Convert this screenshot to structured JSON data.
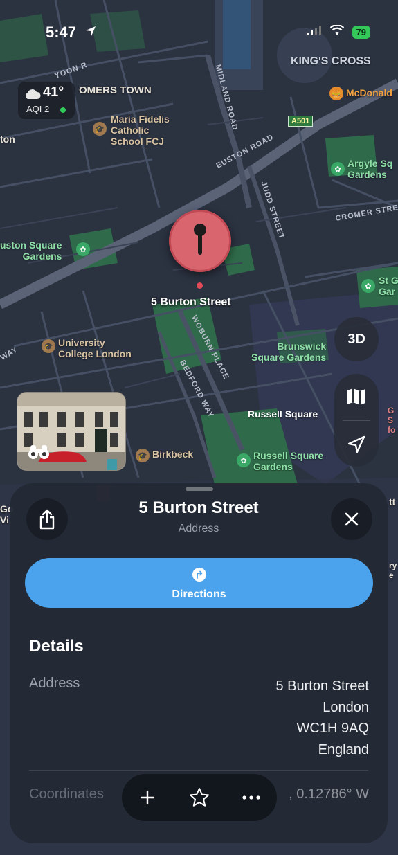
{
  "status_bar": {
    "time": "5:47",
    "battery": "79"
  },
  "weather": {
    "temperature": "41°",
    "aqi_label": "AQI 2"
  },
  "map_labels": {
    "somers_town": "OMERS TOWN",
    "kings_cross": "KING'S CROSS",
    "mcdonalds": "McDonald",
    "maria_fidelis": "Maria Fidelis\nCatholic\nSchool FCJ",
    "ton": "ton",
    "a501": "A501",
    "argyle": "Argyle Sq\nGardens",
    "euston_square_gardens": "uston Square\nGardens",
    "st_gardens": "St G\nGar",
    "ucl": "University\nCollege London",
    "brunswick": "Brunswick\nSquare Gardens",
    "russell_square": "Russell Square",
    "russell_square_gardens": "Russell Square\nGardens",
    "birkbeck": "Birkbeck",
    "gs": "G\nS\nfo",
    "gc": "Go\nVi",
    "tt": "tt",
    "ry": "ry\ne"
  },
  "street_labels": {
    "midland_road": "MIDLAND ROAD",
    "euston_road": "EUSTON ROAD",
    "judd_street": "JUDD STREET",
    "cromer_street": "CROMER STRE",
    "woburn_place": "WOBURN PLACE",
    "bedford_way": "BEDFORD WAY",
    "way": "WAY",
    "yoon": "YOON R"
  },
  "pin": {
    "label": "5 Burton Street"
  },
  "controls": {
    "three_d_label": "3D"
  },
  "place_card": {
    "title": "5 Burton Street",
    "subtitle": "Address",
    "directions_label": "Directions",
    "details_heading": "Details",
    "address_key": "Address",
    "address_lines": [
      "5 Burton Street",
      "London",
      "WC1H 9AQ",
      "England"
    ],
    "coordinates_key": "Coordinates",
    "coordinates_value": ", 0.12786° W"
  },
  "colors": {
    "map_background": "#2a3140",
    "pin": "#d9656e",
    "directions_button": "#4aa3ec",
    "sheet": "#242a34",
    "park": "#2f6b4a"
  },
  "icons": {
    "location_arrow": "location-arrow-icon",
    "share": "share-icon",
    "close": "close-icon",
    "directions": "directions-turn-icon",
    "add": "plus-icon",
    "favorite": "star-icon",
    "more": "ellipsis-icon",
    "map_mode": "map-icon",
    "track_location": "location-arrow-icon",
    "binoculars": "binoculars-icon"
  }
}
